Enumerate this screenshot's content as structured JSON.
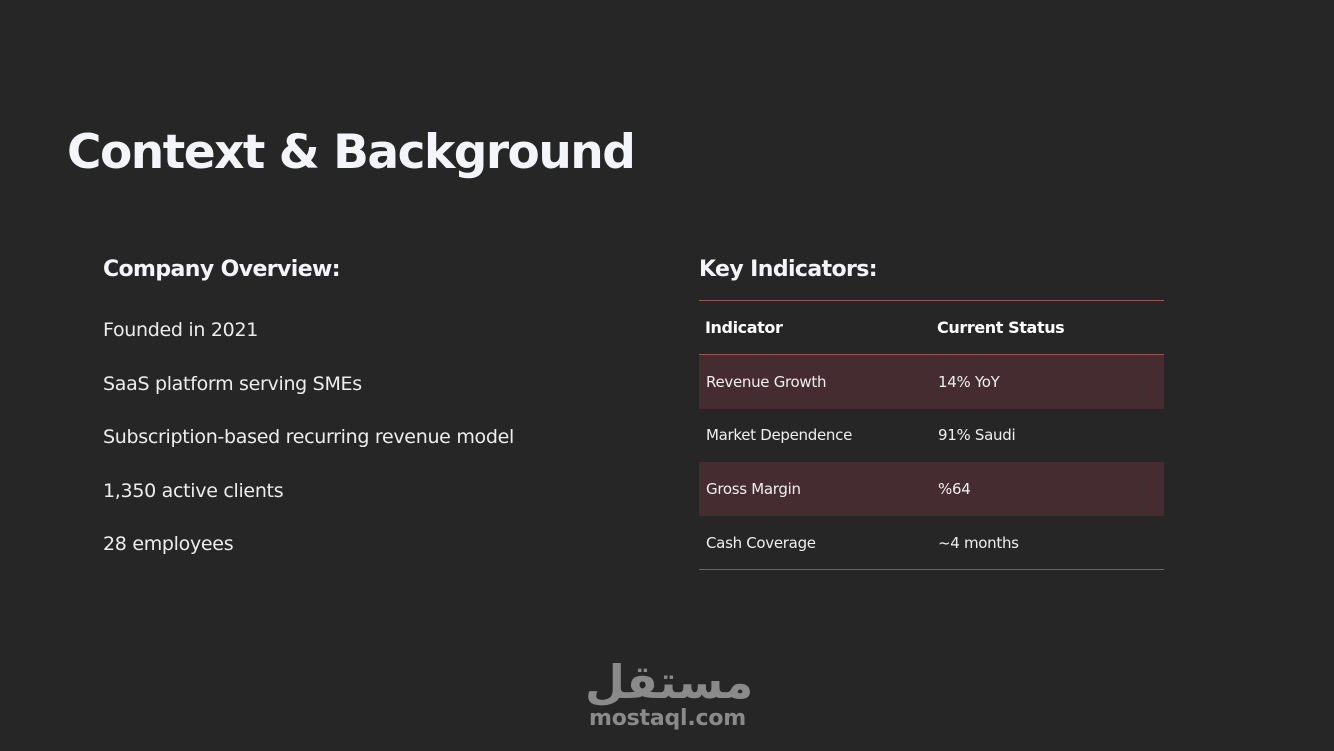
{
  "slide": {
    "title": "Context & Background"
  },
  "overview": {
    "heading": "Company Overview:",
    "items": [
      "Founded in 2021",
      "SaaS platform serving SMEs",
      "Subscription-based recurring revenue model",
      "1,350 active clients",
      "28 employees"
    ]
  },
  "indicators": {
    "heading": "Key Indicators:",
    "columns": [
      "Indicator",
      "Current Status"
    ],
    "rows": [
      {
        "indicator": "Revenue Growth",
        "status": "14% YoY"
      },
      {
        "indicator": "Market Dependence",
        "status": "91% Saudi"
      },
      {
        "indicator": "Gross Margin",
        "status": "%64"
      },
      {
        "indicator": "Cash Coverage",
        "status": "~4 months"
      }
    ]
  },
  "watermark": {
    "arabic": "مستقل",
    "latin": "mostaql.com"
  },
  "colors": {
    "background": "#262626",
    "table_rule": "#9a5252",
    "row_shade": "#452c30",
    "watermark": "#8a8a8a"
  }
}
